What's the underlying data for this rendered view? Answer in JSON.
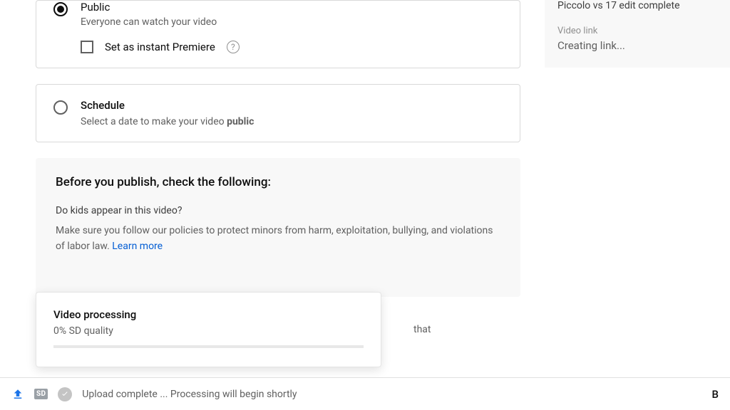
{
  "visibility": {
    "public": {
      "label": "Public",
      "description": "Everyone can watch your video",
      "premiere_label": "Set as instant Premiere"
    }
  },
  "schedule": {
    "label": "Schedule",
    "description_prefix": "Select a date to make your video ",
    "description_bold": "public"
  },
  "before_publish": {
    "title": "Before you publish, check the following:",
    "kids_q": "Do kids appear in this video?",
    "kids_body": "Make sure you follow our policies to protect minors from harm, exploitation, bullying, and violations of labor law. ",
    "learn_more": "Learn more",
    "orphan_text": "that"
  },
  "tooltip": {
    "title": "Video processing",
    "progress_text": "0% SD quality"
  },
  "side": {
    "video_title": "Piccolo vs 17 edit complete",
    "link_label": "Video link",
    "link_status": "Creating link..."
  },
  "bottom": {
    "sd_label": "SD",
    "status": "Upload complete ... Processing will begin shortly",
    "right_char": "B"
  },
  "icons": {
    "help_char": "?"
  }
}
